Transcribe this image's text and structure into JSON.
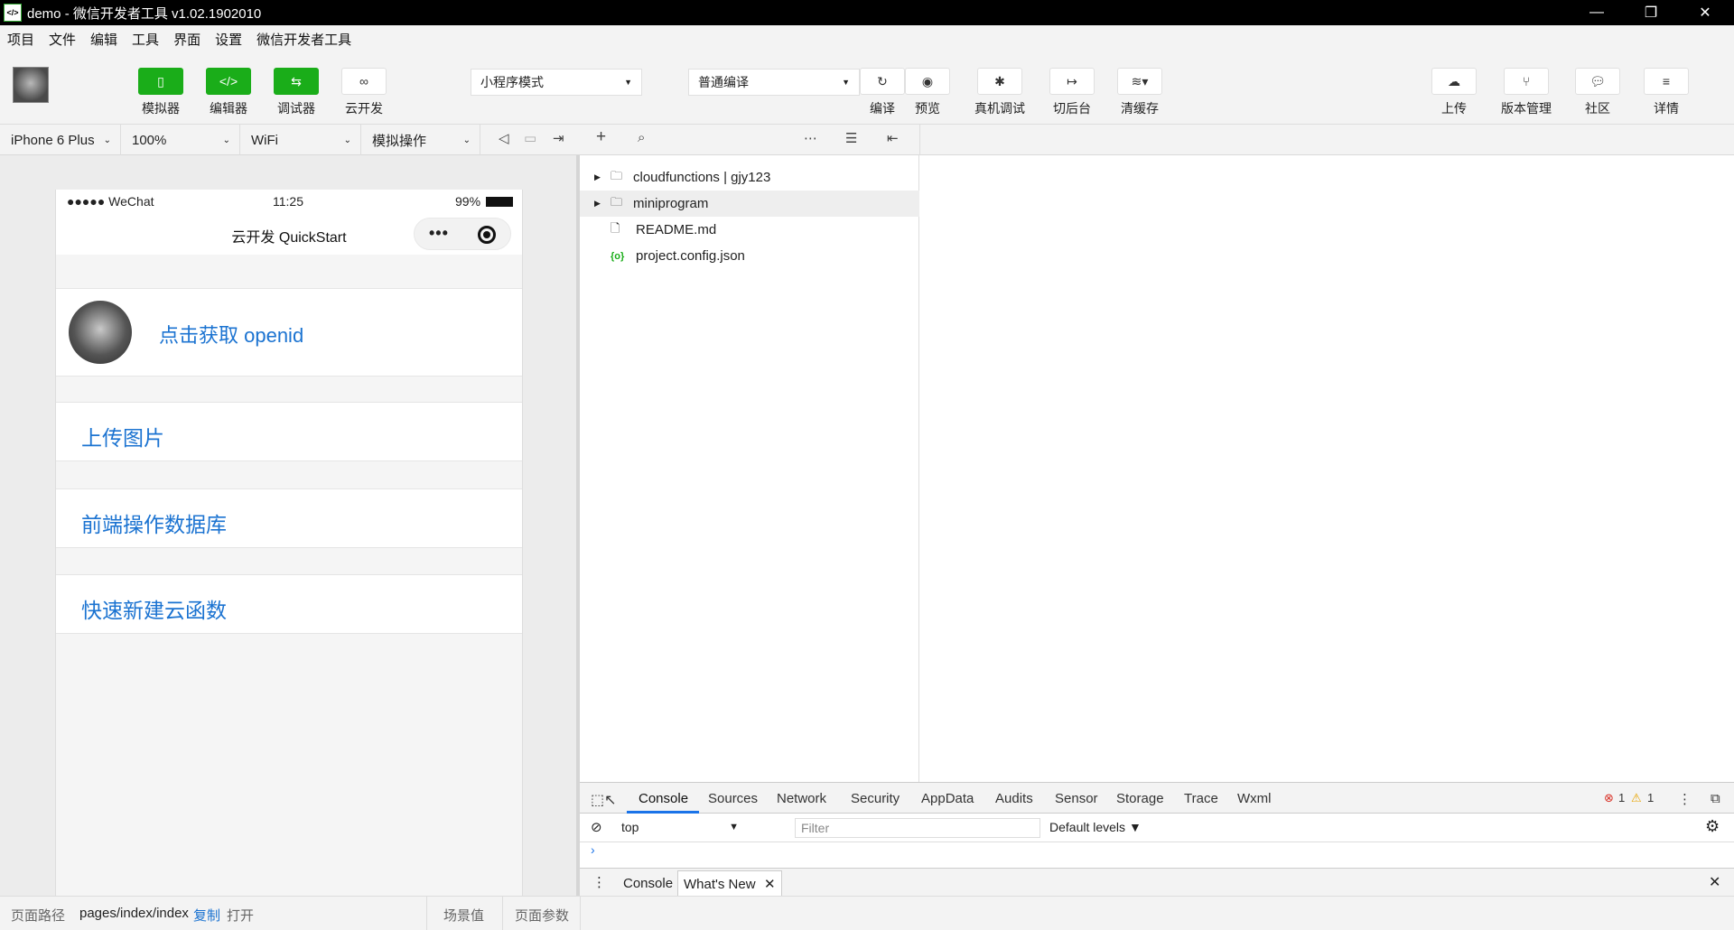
{
  "window": {
    "title": "demo - 微信开发者工具 v1.02.1902010",
    "app_icon": "</>"
  },
  "menu": [
    "项目",
    "文件",
    "编辑",
    "工具",
    "界面",
    "设置",
    "微信开发者工具"
  ],
  "toolbar": {
    "simulator": "模拟器",
    "editor": "编辑器",
    "debugger": "调试器",
    "cloud": "云开发",
    "mode_select": "小程序模式",
    "compile_select": "普通编译",
    "compile": "编译",
    "preview": "预览",
    "remote_debug": "真机调试",
    "background": "切后台",
    "clear_cache": "清缓存",
    "upload": "上传",
    "version": "版本管理",
    "community": "社区",
    "details": "详情"
  },
  "subbar": {
    "device": "iPhone 6 Plus",
    "zoom": "100%",
    "network": "WiFi",
    "operation": "模拟操作"
  },
  "phone": {
    "carrier": "●●●●● WeChat",
    "time": "11:25",
    "battery": "99%",
    "nav_title": "云开发 QuickStart",
    "dots": "•••",
    "openid": "点击获取 openid",
    "items": [
      "上传图片",
      "前端操作数据库",
      "快速新建云函数"
    ]
  },
  "filetree": [
    {
      "name": "cloudfunctions | gjy123",
      "type": "folder"
    },
    {
      "name": "miniprogram",
      "type": "folder"
    },
    {
      "name": "README.md",
      "type": "file"
    },
    {
      "name": "project.config.json",
      "type": "json"
    }
  ],
  "devtools": {
    "tabs": [
      "Console",
      "Sources",
      "Network",
      "Security",
      "AppData",
      "Audits",
      "Sensor",
      "Storage",
      "Trace",
      "Wxml"
    ],
    "errors": "1",
    "warnings": "1",
    "context": "top",
    "filter_placeholder": "Filter",
    "levels": "Default levels",
    "drawer_tabs": [
      "Console",
      "What's New"
    ]
  },
  "status": {
    "path_label": "页面路径",
    "path": "pages/index/index",
    "copy": "复制",
    "open": "打开",
    "scene": "场景值",
    "params": "页面参数"
  }
}
